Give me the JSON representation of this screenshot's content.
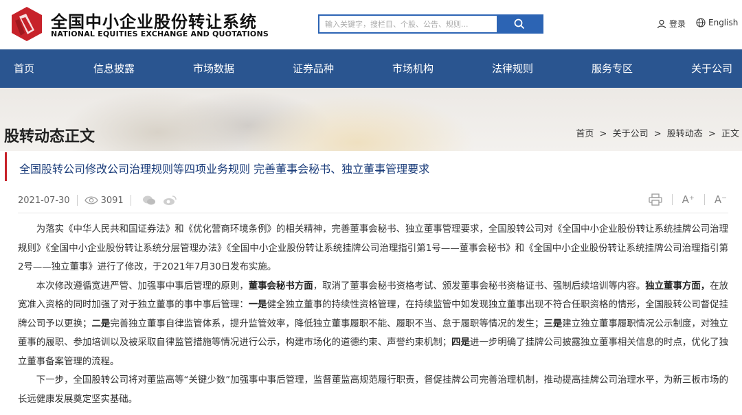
{
  "header": {
    "brand_cn": "全国中小企业股份转让系统",
    "brand_en": "NATIONAL EQUITIES EXCHANGE AND QUOTATIONS",
    "search_placeholder": "输入关键字，搜栏目、个股、公告、规则...",
    "login_label": "登录",
    "lang_label": "English",
    "accent": "#2c64b4",
    "logo_color": "#c7222a"
  },
  "nav": {
    "bg": "#2a5590",
    "items": [
      "首页",
      "信息披露",
      "市场数据",
      "证券品种",
      "市场机构",
      "法律规则",
      "服务专区",
      "关于公司"
    ]
  },
  "banner": {
    "page_title": "股转动态正文",
    "breadcrumb": [
      "首页",
      "关于公司",
      "股转动态",
      "正文"
    ],
    "breadcrumb_sep": ">"
  },
  "article": {
    "title": "全国股转公司修改公司治理规则等四项业务规则 完善董事会秘书、独立董事管理要求",
    "date": "2021-07-30",
    "views": "3091",
    "font_plus": "A⁺",
    "font_minus": "A⁻",
    "p1": "为落实《中华人民共和国证券法》和《优化营商环境条例》的相关精神，完善董事会秘书、独立董事管理要求，全国股转公司对《全国中小企业股份转让系统挂牌公司治理规则》《全国中小企业股份转让系统分层管理办法》《全国中小企业股份转让系统挂牌公司治理指引第1号——董事会秘书》和《全国中小企业股份转让系统挂牌公司治理指引第2号——独立董事》进行了修改，于2021年7月30日发布实施。",
    "p2": {
      "s1": "本次修改遵循宽进严管、加强事中事后管理的原则，",
      "b1": "董事会秘书方面",
      "s2": "，取消了董事会秘书资格考试、颁发董事会秘书资格证书、强制后续培训等内容。",
      "b2": "独立董事方面，",
      "s3": "在放宽准入资格的同时加强了对于独立董事的事中事后管理：",
      "b3": "一是",
      "s4": "健全独立董事的持续性资格管理，在持续监管中如发现独立董事出现不符合任职资格的情形，全国股转公司督促挂牌公司予以更换；",
      "b4": "二是",
      "s5": "完善独立董事自律监管体系，提升监管效率，降低独立董事履职不能、履职不当、怠于履职等情况的发生；",
      "b5": "三是",
      "s6": "建立独立董事履职情况公示制度，对独立董事的履职、参加培训以及被采取自律监管措施等情况进行公示，构建市场化的道德约束、声誉约束机制；",
      "b6": "四是",
      "s7": "进一步明确了挂牌公司披露独立董事相关信息的时点，优化了独立董事备案管理的流程。"
    },
    "p3": "下一步，全国股转公司将对董监高等“关键少数”加强事中事后管理，监督董监高规范履行职责，督促挂牌公司完善治理机制，推动提高挂牌公司治理水平，为新三板市场的长远健康发展奠定坚实基础。"
  }
}
